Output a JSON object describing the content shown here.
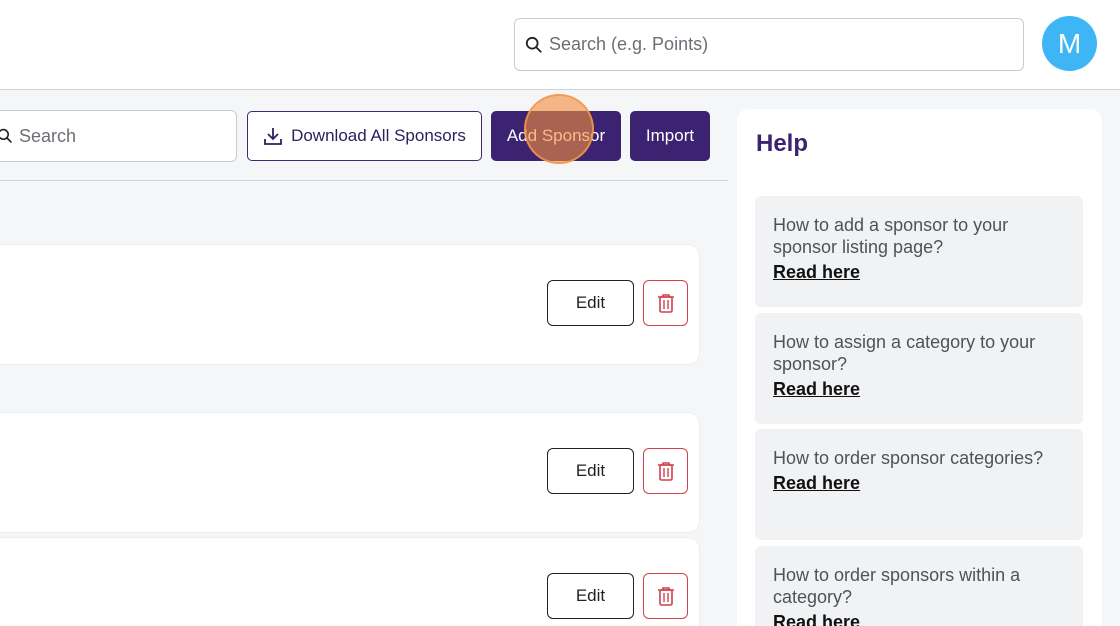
{
  "header": {
    "search_placeholder": "Search (e.g. Points)",
    "avatar_initial": "M",
    "avatar_color": "#3eb6f5"
  },
  "toolbar": {
    "search_placeholder": "Search",
    "download_label": "Download All Sponsors",
    "add_label": "Add Sponsor",
    "import_label": "Import",
    "accent_color": "#3b2372"
  },
  "sponsors": [
    {
      "edit_label": "Edit"
    },
    {
      "edit_label": "Edit"
    },
    {
      "edit_label": "Edit"
    }
  ],
  "help": {
    "title": "Help",
    "items": [
      {
        "question": "How to add a sponsor to your sponsor listing page?",
        "link": "Read here"
      },
      {
        "question": "How to assign a category to your sponsor?",
        "link": "Read here"
      },
      {
        "question": "How to order sponsor categories?",
        "link": "Read here"
      },
      {
        "question": "How to order sponsors within a category?",
        "link": "Read here"
      }
    ]
  }
}
